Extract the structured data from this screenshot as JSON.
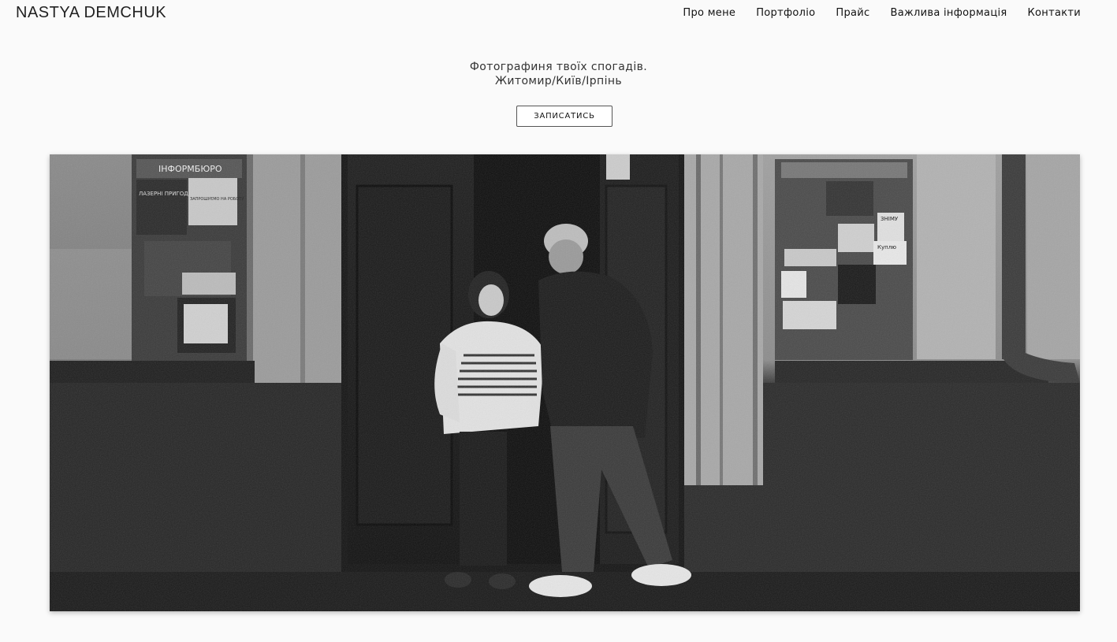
{
  "header": {
    "logo": "NASTYA DEMCHUK",
    "nav": [
      {
        "label": "Про мене"
      },
      {
        "label": "Портфоліо"
      },
      {
        "label": "Прайс"
      },
      {
        "label": "Важлива інформація"
      },
      {
        "label": "Контакти"
      }
    ]
  },
  "hero": {
    "line1": "Фотографиня твоїх спогадів.",
    "line2": "Житомир/Київ/Ірпінь",
    "cta_label": "ЗАПИСАТИСЬ"
  },
  "photo": {
    "poster_left_title": "ІНФОРМБЮРО",
    "poster_left_text": "ЛАЗЕРНІ ПРИГОДИ",
    "poster_left_text2": "ЗАПРОШУЄМО НА РОБОТУ",
    "poster_right_text": "ЗНІМУ",
    "poster_right_text2": "Куплю"
  }
}
